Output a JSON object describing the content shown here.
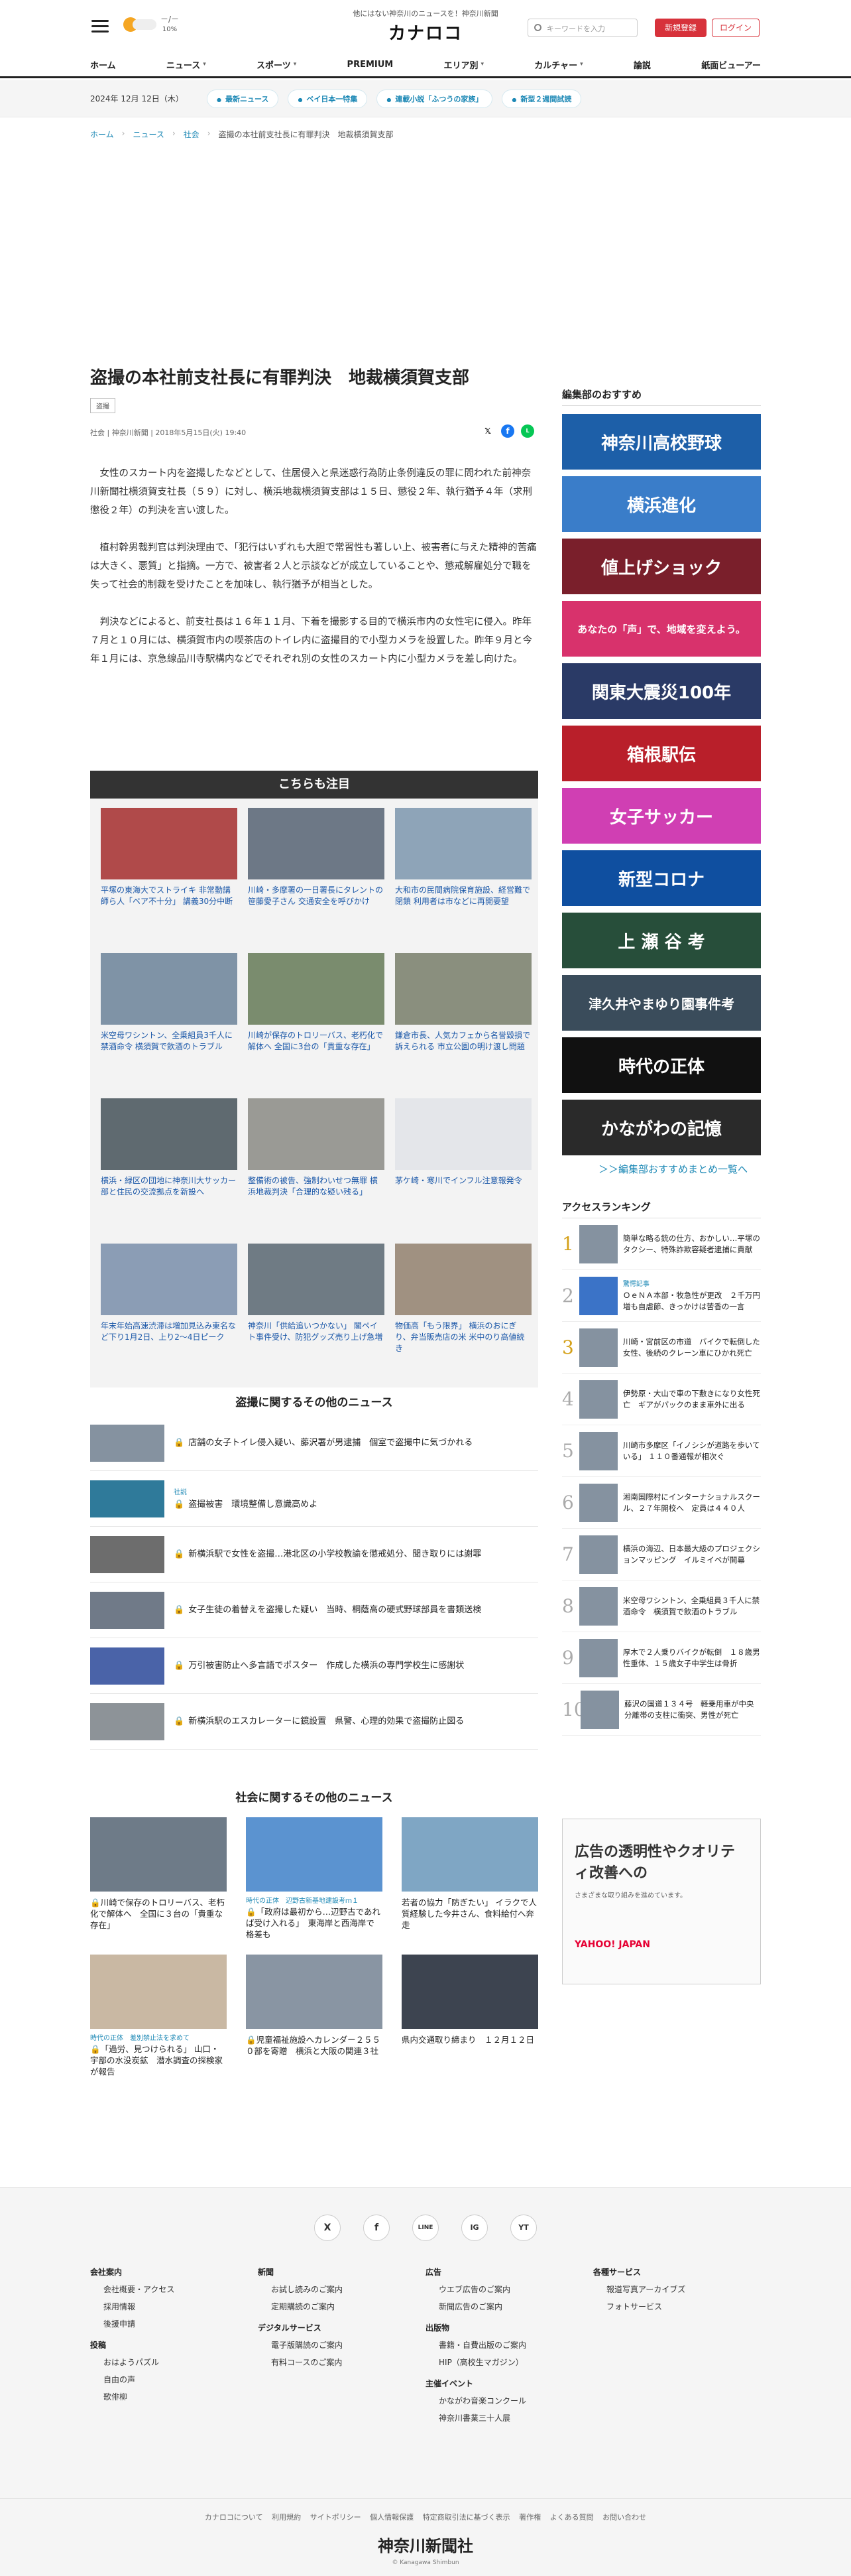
{
  "header": {
    "tagline": "他にはない神奈川のニュースを！神奈川新聞",
    "logo": "カナロコ",
    "weather": "－/－",
    "weather_sub": "10%",
    "search_placeholder": "キーワードを入力",
    "register_label": "新規登録",
    "login_label": "ログイン",
    "nav": [
      {
        "label": "ホーム"
      },
      {
        "label": "ニュース"
      },
      {
        "label": "スポーツ"
      },
      {
        "label": "PREMIUM"
      },
      {
        "label": "エリア別"
      },
      {
        "label": "カルチャー"
      },
      {
        "label": "論説"
      },
      {
        "label": "紙面ビューアー"
      }
    ]
  },
  "subbar": {
    "date": "2024年 12月 12日（木）",
    "pills": [
      "最新ニュース",
      "ベイ日本一特集",
      "連載小説「ふつうの家族」",
      "新型２週間試読"
    ]
  },
  "breadcrumb": [
    "ホーム",
    "ニュース",
    "社会",
    "盗撮の本社前支社長に有罪判決　地裁横須賀支部"
  ],
  "article": {
    "title": "盗撮の本社前支社長に有罪判決　地裁横須賀支部",
    "tag": "盗撮",
    "meta": "社会 | 神奈川新聞 | 2018年5月15日(火) 19:40",
    "paragraphs": [
      "女性のスカート内を盗撮したなどとして、住居侵入と県迷惑行為防止条例違反の罪に問われた前神奈川新聞社横須賀支社長（５９）に対し、横浜地裁横須賀支部は１５日、懲役２年、執行猶予４年（求刑懲役２年）の判決を言い渡した。",
      "植村幹男裁判官は判決理由で、「犯行はいずれも大胆で常習性も著しい上、被害者に与えた精神的苦痛は大きく、悪質」と指摘。一方で、被害者２人と示談などが成立していることや、懲戒解雇処分で職を失って社会的制裁を受けたことを加味し、執行猶予が相当とした。",
      "判決などによると、前支社長は１６年１１月、下着を撮影する目的で横浜市内の女性宅に侵入。昨年７月と１０月には、横須賀市内の喫茶店のトイレ内に盗撮目的で小型カメラを設置した。昨年９月と今年１月には、京急線品川寺駅構内などでそれぞれ別の女性のスカート内に小型カメラを差し向けた。"
    ]
  },
  "kochira": {
    "heading": "こちらも注目",
    "items": [
      "平塚の東海大でストライキ 非常勤講師ら人「ベア不十分」 講義30分中断",
      "川崎・多摩署の一日署長にタレントの笹藤愛子さん 交通安全を呼びかけ",
      "大和市の民間病院保育施設、経営難で閉鎖 利用者は市などに再開要望",
      "米空母ワシントン、全乗組員3千人に禁酒命令 横須賀で飲酒のトラブル",
      "川崎が保存のトロリーバス、老朽化で解体へ 全国に3台の「貴重な存在」",
      "鎌倉市長、人気カフェから名誉毀損で訴えられる 市立公園の明け渡し問題",
      "横浜・緑区の団地に神奈川大サッカー部と住民の交流拠点を新設へ",
      "整備術の被告、強制わいせつ無罪 横浜地裁判決「合理的な疑い残る」",
      "茅ケ崎・寒川でインフル注意報発令",
      "年末年始高速渋滞は増加見込み東名など下り1月2日、上り2～4日ピーク",
      "神奈川「供給追いつかない」 閣ペイト事件受け、防犯グッズ売り上げ急増",
      "物価高「もう限界」 横浜のおにぎり、弁当販売店の米 米中のり高値続き"
    ]
  },
  "related": {
    "heading": "盗撮に関するその他のニュース",
    "items": [
      {
        "tag": "",
        "text": "店舗の女子トイレ侵入疑い、藤沢署が男逮捕　個室で盗撮中に気づかれる"
      },
      {
        "tag": "社説",
        "text": "盗撮被害　環境整備し意識高めよ"
      },
      {
        "tag": "",
        "text": "新横浜駅で女性を盗撮…港北区の小学校教諭を懲戒処分、聞き取りには謝罪"
      },
      {
        "tag": "",
        "text": "女子生徒の着替えを盗撮した疑い　当時、桐蔭高の硬式野球部員を書類送検"
      },
      {
        "tag": "",
        "text": "万引被害防止へ多言語でポスター　作成した横浜の専門学校生に感謝状"
      },
      {
        "tag": "",
        "text": "新横浜駅のエスカレーターに鏡設置　県警、心理的効果で盗撮防止図る"
      }
    ]
  },
  "social": {
    "heading": "社会に関するその他のニュース",
    "items": [
      {
        "tag": "",
        "text": "川崎で保存のトロリーバス、老朽化で解体へ　全国に３台の「貴重な存在」"
      },
      {
        "tag": "時代の正体　辺野古新基地建設考ｍ１",
        "text": "「政府は最初から…辺野古であれば受け入れる」　東海岸と西海岸で格差も"
      },
      {
        "tag": "",
        "text": "若者の協力「防ぎたい」 イラクで人質経験した今井さん、食料給付へ奔走"
      },
      {
        "tag": "時代の正体　差別禁止法を求めて",
        "text": "「過労、見つけられる」 山口・宇部の水没炭鉱　潜水調査の探検家が報告"
      },
      {
        "tag": "",
        "text": "児童福祉施設へカレンダー２５５０部を寄贈　横浜と大阪の関連３社"
      },
      {
        "tag": "",
        "text": "県内交通取り締まり　１２月１２日"
      }
    ]
  },
  "sidebar": {
    "recommend_heading": "編集部のおすすめ",
    "banners": [
      {
        "text": "神奈川高校野球",
        "bg": "#1d5fa8"
      },
      {
        "text": "横浜進化",
        "bg": "#3a7dc9"
      },
      {
        "text": "値上げショック",
        "bg": "#7a1f2b"
      },
      {
        "text": "あなたの「声」で、地域を変えよう。",
        "bg": "#d8326c"
      },
      {
        "text": "関東大震災100年",
        "bg": "#2a3a66"
      },
      {
        "text": "箱根駅伝",
        "bg": "#b91f2a"
      },
      {
        "text": "女子サッカー",
        "bg": "#d03fb3"
      },
      {
        "text": "新型コロナ",
        "bg": "#0f4fa0"
      },
      {
        "text": "上 瀬 谷 考",
        "bg": "#274e3a"
      },
      {
        "text": "津久井やまゆり園事件考",
        "bg": "#3a4c5b"
      },
      {
        "text": "時代の正体",
        "bg": "#111111"
      },
      {
        "text": "かながわの記憶",
        "bg": "#2a2a2a"
      }
    ],
    "matome": "＞＞編集部おすすめまとめ一覧へ",
    "ranking_heading": "アクセスランキング",
    "ranking": [
      {
        "tag": "",
        "text": "簡単な略る銃の仕方、おかしい…平塚のタクシー、特殊詐欺容疑者逮捕に貢献"
      },
      {
        "tag": "驚愕記事",
        "text": "ＯｅＮＡ本部・牧急性が更改　２千万円増も自虐節、きっかけは苦香の一言"
      },
      {
        "tag": "",
        "text": "川崎・宮前区の市道　バイクで転倒した女性、後続のクレーン車にひかれ死亡"
      },
      {
        "tag": "",
        "text": "伊勢原・大山で車の下敷きになり女性死亡　ギアがパックのまま車外に出る"
      },
      {
        "tag": "",
        "text": "川崎市多摩区「イノシシが道路を歩いている」 １１０番通報が相次ぐ"
      },
      {
        "tag": "",
        "text": "湘南国際村にインターナショナルスクール、２７年開校へ　定員は４４０人"
      },
      {
        "tag": "",
        "text": "横浜の海辺、日本最大級のプロジェクションマッピング　イルミイベが開幕"
      },
      {
        "tag": "",
        "text": "米空母ワシントン、全乗組員３千人に禁酒命令　横須賀で飲酒のトラブル"
      },
      {
        "tag": "",
        "text": "厚木で２人乗りバイクが転倒　１８歳男性重体、１５歳女子中学生は骨折"
      },
      {
        "tag": "",
        "text": "藤沢の国道１３４号　軽乗用車が中央分離帯の支柱に衝突、男性が死亡"
      }
    ],
    "ad_text": "広告の透明性やクオリティ改善への",
    "ad_sub": "さまざまな取り組みを進めています。",
    "ad_brand": "YAHOO! JAPAN"
  },
  "footer": {
    "sns": [
      "X",
      "f",
      "LINE",
      "IG",
      "YT"
    ],
    "cols": [
      {
        "groups": [
          {
            "h": "会社案内",
            "items": [
              "会社概要・アクセス",
              "採用情報",
              "後援申請"
            ]
          },
          {
            "h": "投稿",
            "items": [
              "おはようパズル",
              "自由の声",
              "歌俳柳"
            ]
          }
        ]
      },
      {
        "groups": [
          {
            "h": "新聞",
            "items": [
              "お試し読みのご案内",
              "定期購読のご案内"
            ]
          },
          {
            "h": "デジタルサービス",
            "items": [
              "電子版購読のご案内",
              "有料コースのご案内"
            ]
          }
        ]
      },
      {
        "groups": [
          {
            "h": "広告",
            "items": [
              "ウエブ広告のご案内",
              "新聞広告のご案内"
            ]
          },
          {
            "h": "出版物",
            "items": [
              "書籍・自費出版のご案内",
              "HIP（高校生マガジン）"
            ]
          },
          {
            "h": "主催イベント",
            "items": [
              "かながわ音楽コンクール",
              "神奈川書業三十人展"
            ]
          }
        ]
      },
      {
        "groups": [
          {
            "h": "各種サービス",
            "items": [
              "報道写真アーカイブズ",
              "フォトサービス"
            ]
          }
        ]
      }
    ],
    "links": "カナロコについて 利用規約 サイトポリシー 個人情報保護 特定商取引法に基づく表示 著作権 よくある質問 お問い合わせ",
    "logo": "神奈川新聞社",
    "copyright": "© Kanagawa Shimbun"
  }
}
